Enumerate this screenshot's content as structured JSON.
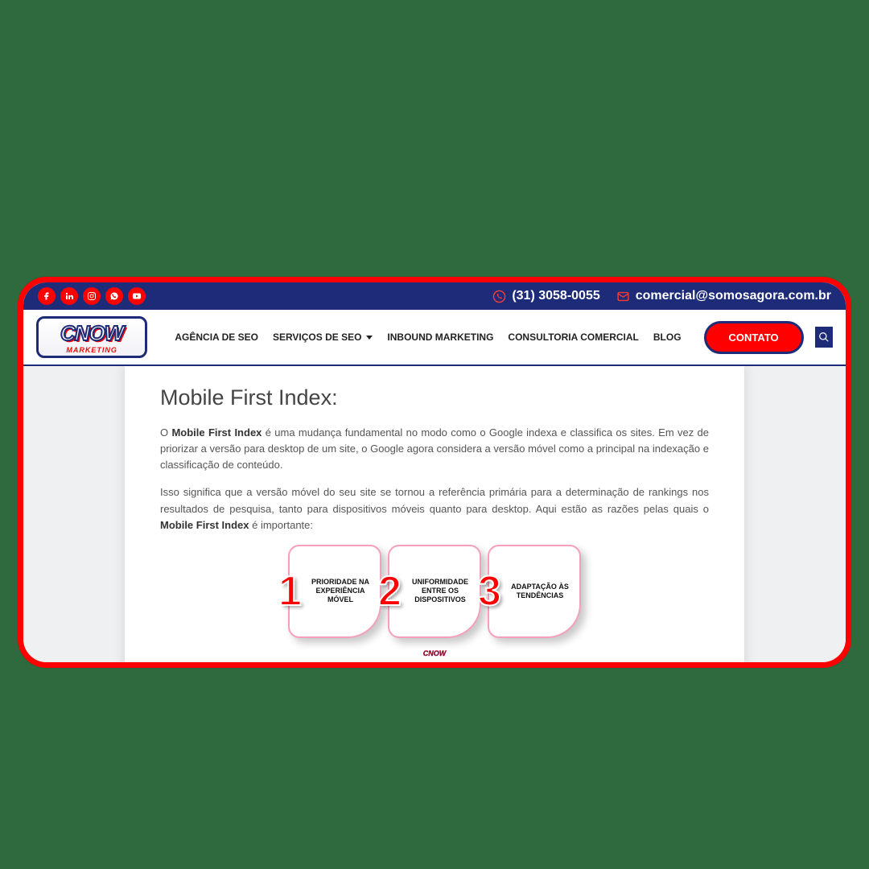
{
  "topbar": {
    "phone": "(31) 3058-0055",
    "email": "comercial@somosagora.com.br",
    "social": {
      "facebook": "facebook",
      "linkedin": "linkedin",
      "instagram": "instagram",
      "whatsapp": "whatsapp",
      "youtube": "youtube"
    }
  },
  "logo": {
    "main": "CNOW",
    "sub": "MARKETING"
  },
  "nav": {
    "agencia": "AGÊNCIA DE SEO",
    "servicos": "SERVIÇOS DE SEO",
    "inbound": "INBOUND MARKETING",
    "consultoria": "CONSULTORIA COMERCIAL",
    "blog": "BLOG",
    "contato": "CONTATO"
  },
  "content": {
    "heading": "Mobile First Index:",
    "p1_pre": "O ",
    "p1_b1": "Mobile First Index",
    "p1_rest": " é uma mudança fundamental no modo como o Google indexa e classifica os sites. Em vez de priorizar a versão para desktop de um site, o Google agora considera a versão móvel como a principal na indexação e classificação de conteúdo.",
    "p2_pre": "Isso significa que a versão móvel do seu site se tornou a referência primária para a determinação de rankings nos resultados de pesquisa, tanto para dispositivos móveis quanto para desktop. Aqui estão as razões pelas quais o ",
    "p2_b": "Mobile First Index",
    "p2_rest": " é importante:"
  },
  "steps": [
    {
      "n": "1",
      "label": "PRIORIDADE NA EXPERIÊNCIA MÓVEL"
    },
    {
      "n": "2",
      "label": "UNIFORMIDADE ENTRE OS DISPOSITIVOS"
    },
    {
      "n": "3",
      "label": "ADAPTAÇÃO ÀS TENDÊNCIAS"
    }
  ],
  "minilogo": "CNOW"
}
